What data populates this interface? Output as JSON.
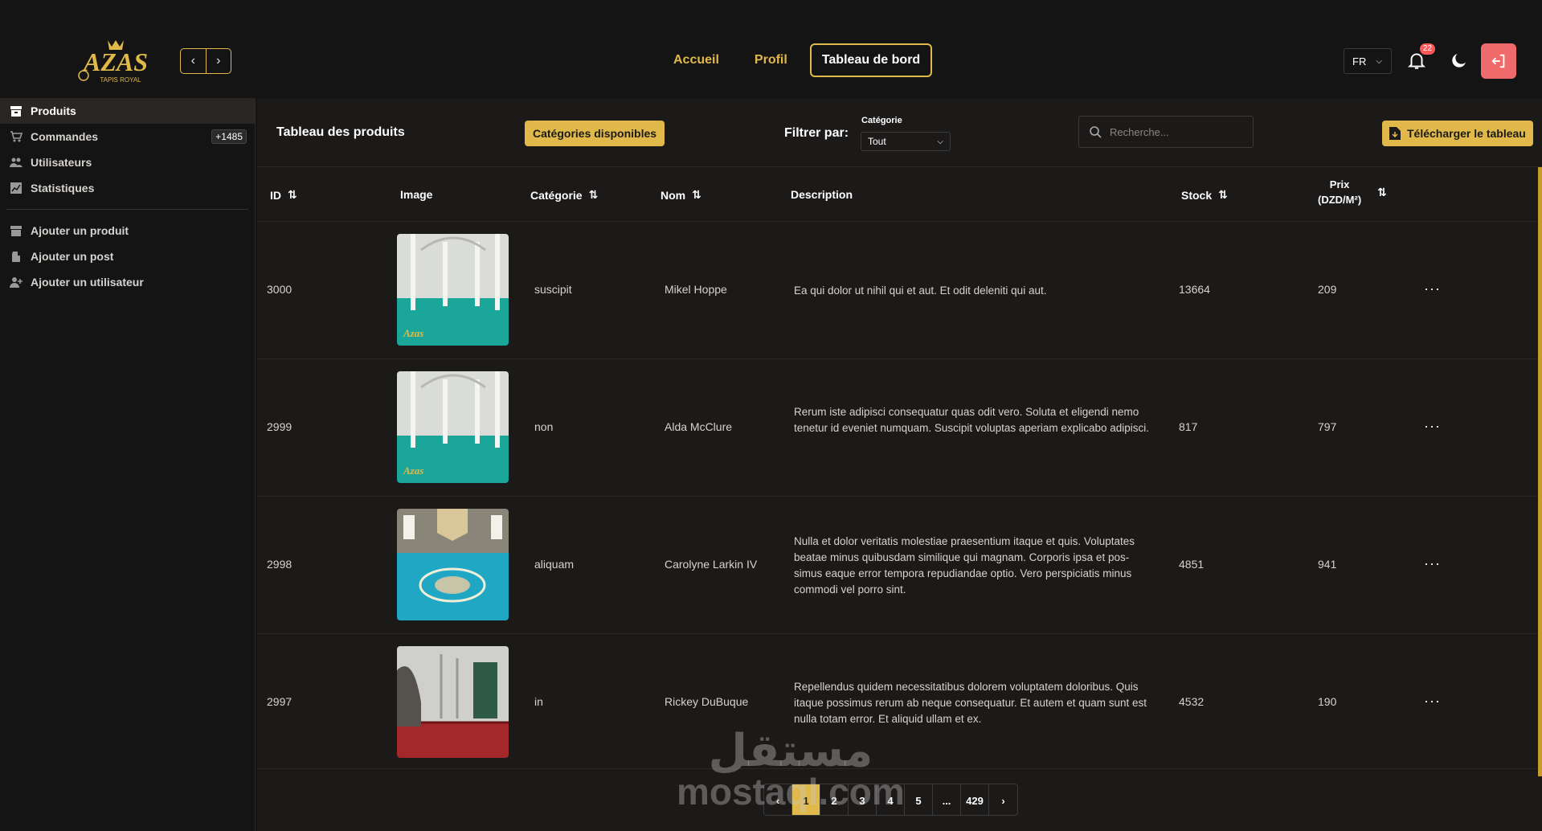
{
  "window": {
    "min_icon": "minimize-icon",
    "max_icon": "maximize-icon",
    "close_icon": "close-icon"
  },
  "brand": {
    "logo_text": "AZAS",
    "logo_sub": "TAPIS ROYAL",
    "accent": "#e0b94a"
  },
  "topnav": {
    "home": "Accueil",
    "profile": "Profil",
    "dashboard": "Tableau de bord"
  },
  "header": {
    "lang": "FR",
    "notif_count": "22"
  },
  "sidebar": {
    "items": [
      {
        "label": "Produits",
        "icon": "box-icon"
      },
      {
        "label": "Commandes",
        "icon": "cart-icon",
        "count": "+1485"
      },
      {
        "label": "Utilisateurs",
        "icon": "users-icon"
      },
      {
        "label": "Statistiques",
        "icon": "chart-icon"
      }
    ],
    "actions": [
      {
        "label": "Ajouter un produit",
        "icon": "box-add-icon"
      },
      {
        "label": "Ajouter un post",
        "icon": "post-add-icon"
      },
      {
        "label": "Ajouter un utilisateur",
        "icon": "user-add-icon"
      }
    ]
  },
  "toolbar": {
    "title": "Tableau des produits",
    "categories_button": "Catégories disponibles",
    "filter_label": "Filtrer par:",
    "category_label": "Catégorie",
    "category_value": "Tout",
    "search_placeholder": "Recherche...",
    "download_button": "Télécharger le tableau"
  },
  "table": {
    "headers": {
      "id": "ID",
      "image": "Image",
      "category": "Catégorie",
      "name": "Nom",
      "description": "Description",
      "stock": "Stock",
      "price_l1": "Prix",
      "price_l2": "(DZD/M²)"
    },
    "rows": [
      {
        "id": "3000",
        "category": "suscipit",
        "name": "Mikel Hoppe",
        "description": "Ea qui dolor ut nihil qui et aut. Et odit deleniti qui aut.",
        "stock": "13664",
        "price": "209",
        "image": "mosque-green-carpet"
      },
      {
        "id": "2999",
        "category": "non",
        "name": "Alda McClure",
        "description": "Rerum iste adipisci consequatur quas odit vero. Soluta et eligendi nemo tenetur id eveniet numquam. Suscipit voluptas aperiam explicabo adipisci.",
        "stock": "817",
        "price": "797",
        "image": "mosque-green-carpet"
      },
      {
        "id": "2998",
        "category": "aliquam",
        "name": "Carolyne Larkin IV",
        "description": "Nulla et dolor veritatis molestiae praesentium itaque et quis. Voluptates beatae minus quibusdam similique qui magnam. Corporis ipsa et pos- simus eaque error tempora repudiandae optio. Vero perspiciatis minus commodi vel porro sint.",
        "stock": "4851",
        "price": "941",
        "image": "mosque-turquoise-carpet"
      },
      {
        "id": "2997",
        "category": "in",
        "name": "Rickey DuBuque",
        "description": "Repellendus quidem necessitatibus dolorem voluptatem doloribus. Quis itaque possimus rerum ab neque consequatur. Et autem et quam sunt est nulla totam error. Et aliquid ullam et ex.",
        "stock": "4532",
        "price": "190",
        "image": "mosque-red-carpet"
      }
    ]
  },
  "pagination": {
    "pages": [
      "1",
      "2",
      "3",
      "4",
      "5",
      "...",
      "429"
    ],
    "current": "1"
  },
  "watermark": {
    "ar": "مستقل",
    "en": "mostaql.com"
  }
}
